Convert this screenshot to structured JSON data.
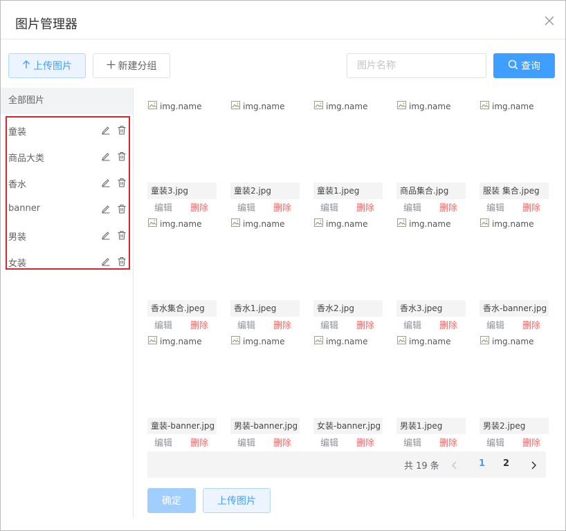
{
  "dialog": {
    "title": "图片管理器",
    "close_icon": "close-icon"
  },
  "toolbar": {
    "upload_label": "上传图片",
    "new_group_label": "新建分组",
    "search_placeholder": "图片名称",
    "search_value": "",
    "query_label": "查询"
  },
  "sidebar": {
    "all_label": "全部图片",
    "groups": [
      {
        "label": "童装"
      },
      {
        "label": "商品大类"
      },
      {
        "label": "香水"
      },
      {
        "label": "banner"
      },
      {
        "label": "男装"
      },
      {
        "label": "女装"
      }
    ],
    "highlight_color": "#d9232f"
  },
  "images": [
    {
      "alt": "img.name",
      "name": "童装3.jpg",
      "edit": "编辑",
      "delete": "删除"
    },
    {
      "alt": "img.name",
      "name": "童装2.jpg",
      "edit": "编辑",
      "delete": "删除"
    },
    {
      "alt": "img.name",
      "name": "童装1.jpeg",
      "edit": "编辑",
      "delete": "删除"
    },
    {
      "alt": "img.name",
      "name": "商品集合.jpg",
      "edit": "编辑",
      "delete": "删除"
    },
    {
      "alt": "img.name",
      "name": "服装 集合.jpeg",
      "edit": "编辑",
      "delete": "删除"
    },
    {
      "alt": "img.name",
      "name": "香水集合.jpeg",
      "edit": "编辑",
      "delete": "删除"
    },
    {
      "alt": "img.name",
      "name": "香水1.jpeg",
      "edit": "编辑",
      "delete": "删除"
    },
    {
      "alt": "img.name",
      "name": "香水2.jpg",
      "edit": "编辑",
      "delete": "删除"
    },
    {
      "alt": "img.name",
      "name": "香水3.jpeg",
      "edit": "编辑",
      "delete": "删除"
    },
    {
      "alt": "img.name",
      "name": "香水-banner.jpg",
      "edit": "编辑",
      "delete": "删除"
    },
    {
      "alt": "img.name",
      "name": "童装-banner.jpg",
      "edit": "编辑",
      "delete": "删除"
    },
    {
      "alt": "img.name",
      "name": "男装-banner.jpg",
      "edit": "编辑",
      "delete": "删除"
    },
    {
      "alt": "img.name",
      "name": "女装-banner.jpg",
      "edit": "编辑",
      "delete": "删除"
    },
    {
      "alt": "img.name",
      "name": "男装1.jpeg",
      "edit": "编辑",
      "delete": "删除"
    },
    {
      "alt": "img.name",
      "name": "男装2.jpeg",
      "edit": "编辑",
      "delete": "删除"
    }
  ],
  "pagination": {
    "total_text": "共 19 条",
    "pages": [
      "1",
      "2"
    ],
    "current_page": "1"
  },
  "footer": {
    "confirm_label": "确定",
    "upload_label": "上传图片"
  },
  "colors": {
    "primary": "#409eff",
    "danger": "#f56c6c",
    "primary_light": "#a0cfff"
  }
}
